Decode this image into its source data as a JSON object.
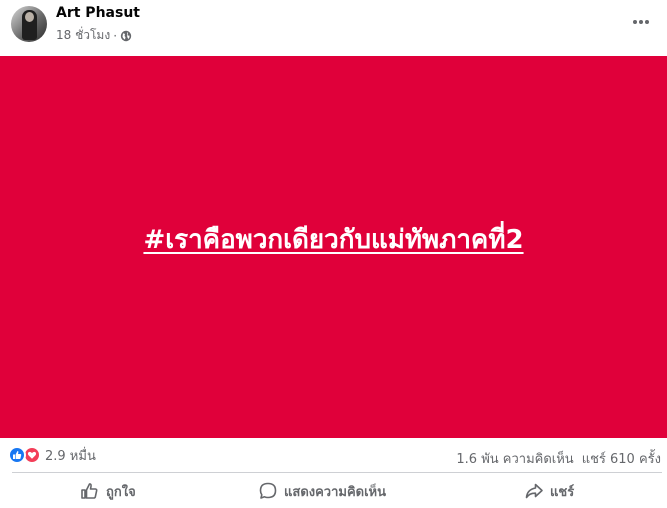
{
  "post": {
    "author": "Art Phasut",
    "time": "18 ชั่วโมง",
    "separator": "·",
    "privacy_icon": "globe-icon",
    "more_icon": "more-horizontal-icon"
  },
  "image": {
    "hashtag": "#เราคือพวกเดียวกับแม่ทัพภาคที่2",
    "background_color": "#e0003a"
  },
  "stats": {
    "reaction_icons": [
      "like-icon",
      "love-icon"
    ],
    "reaction_count": "2.9 หมื่น",
    "comments": "1.6 พัน ความคิดเห็น",
    "shares": "แชร์ 610 ครั้ง"
  },
  "actions": {
    "like": "ถูกใจ",
    "comment": "แสดงความคิดเห็น",
    "share": "แชร์"
  }
}
